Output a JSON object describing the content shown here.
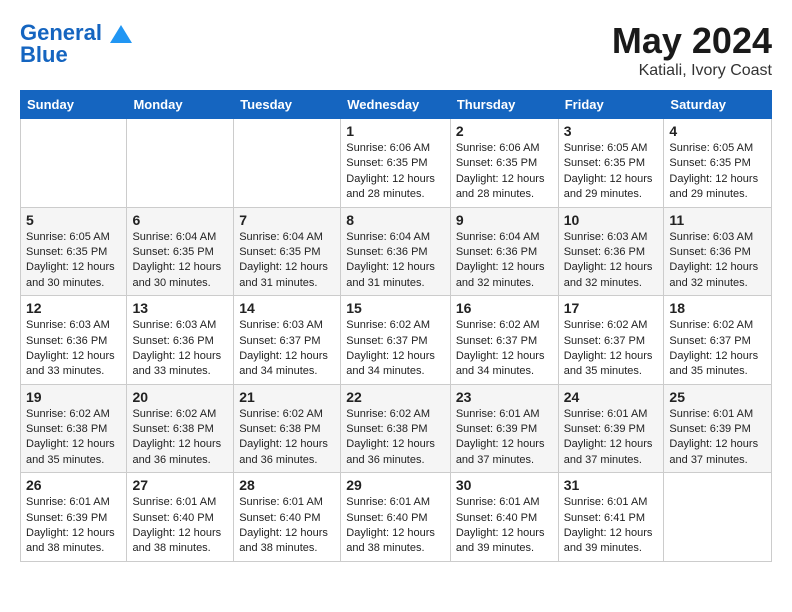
{
  "header": {
    "logo_line1": "General",
    "logo_line2": "Blue",
    "month_year": "May 2024",
    "location": "Katiali, Ivory Coast"
  },
  "weekdays": [
    "Sunday",
    "Monday",
    "Tuesday",
    "Wednesday",
    "Thursday",
    "Friday",
    "Saturday"
  ],
  "weeks": [
    [
      {
        "num": "",
        "detail": ""
      },
      {
        "num": "",
        "detail": ""
      },
      {
        "num": "",
        "detail": ""
      },
      {
        "num": "1",
        "detail": "Sunrise: 6:06 AM\nSunset: 6:35 PM\nDaylight: 12 hours\nand 28 minutes."
      },
      {
        "num": "2",
        "detail": "Sunrise: 6:06 AM\nSunset: 6:35 PM\nDaylight: 12 hours\nand 28 minutes."
      },
      {
        "num": "3",
        "detail": "Sunrise: 6:05 AM\nSunset: 6:35 PM\nDaylight: 12 hours\nand 29 minutes."
      },
      {
        "num": "4",
        "detail": "Sunrise: 6:05 AM\nSunset: 6:35 PM\nDaylight: 12 hours\nand 29 minutes."
      }
    ],
    [
      {
        "num": "5",
        "detail": "Sunrise: 6:05 AM\nSunset: 6:35 PM\nDaylight: 12 hours\nand 30 minutes."
      },
      {
        "num": "6",
        "detail": "Sunrise: 6:04 AM\nSunset: 6:35 PM\nDaylight: 12 hours\nand 30 minutes."
      },
      {
        "num": "7",
        "detail": "Sunrise: 6:04 AM\nSunset: 6:35 PM\nDaylight: 12 hours\nand 31 minutes."
      },
      {
        "num": "8",
        "detail": "Sunrise: 6:04 AM\nSunset: 6:36 PM\nDaylight: 12 hours\nand 31 minutes."
      },
      {
        "num": "9",
        "detail": "Sunrise: 6:04 AM\nSunset: 6:36 PM\nDaylight: 12 hours\nand 32 minutes."
      },
      {
        "num": "10",
        "detail": "Sunrise: 6:03 AM\nSunset: 6:36 PM\nDaylight: 12 hours\nand 32 minutes."
      },
      {
        "num": "11",
        "detail": "Sunrise: 6:03 AM\nSunset: 6:36 PM\nDaylight: 12 hours\nand 32 minutes."
      }
    ],
    [
      {
        "num": "12",
        "detail": "Sunrise: 6:03 AM\nSunset: 6:36 PM\nDaylight: 12 hours\nand 33 minutes."
      },
      {
        "num": "13",
        "detail": "Sunrise: 6:03 AM\nSunset: 6:36 PM\nDaylight: 12 hours\nand 33 minutes."
      },
      {
        "num": "14",
        "detail": "Sunrise: 6:03 AM\nSunset: 6:37 PM\nDaylight: 12 hours\nand 34 minutes."
      },
      {
        "num": "15",
        "detail": "Sunrise: 6:02 AM\nSunset: 6:37 PM\nDaylight: 12 hours\nand 34 minutes."
      },
      {
        "num": "16",
        "detail": "Sunrise: 6:02 AM\nSunset: 6:37 PM\nDaylight: 12 hours\nand 34 minutes."
      },
      {
        "num": "17",
        "detail": "Sunrise: 6:02 AM\nSunset: 6:37 PM\nDaylight: 12 hours\nand 35 minutes."
      },
      {
        "num": "18",
        "detail": "Sunrise: 6:02 AM\nSunset: 6:37 PM\nDaylight: 12 hours\nand 35 minutes."
      }
    ],
    [
      {
        "num": "19",
        "detail": "Sunrise: 6:02 AM\nSunset: 6:38 PM\nDaylight: 12 hours\nand 35 minutes."
      },
      {
        "num": "20",
        "detail": "Sunrise: 6:02 AM\nSunset: 6:38 PM\nDaylight: 12 hours\nand 36 minutes."
      },
      {
        "num": "21",
        "detail": "Sunrise: 6:02 AM\nSunset: 6:38 PM\nDaylight: 12 hours\nand 36 minutes."
      },
      {
        "num": "22",
        "detail": "Sunrise: 6:02 AM\nSunset: 6:38 PM\nDaylight: 12 hours\nand 36 minutes."
      },
      {
        "num": "23",
        "detail": "Sunrise: 6:01 AM\nSunset: 6:39 PM\nDaylight: 12 hours\nand 37 minutes."
      },
      {
        "num": "24",
        "detail": "Sunrise: 6:01 AM\nSunset: 6:39 PM\nDaylight: 12 hours\nand 37 minutes."
      },
      {
        "num": "25",
        "detail": "Sunrise: 6:01 AM\nSunset: 6:39 PM\nDaylight: 12 hours\nand 37 minutes."
      }
    ],
    [
      {
        "num": "26",
        "detail": "Sunrise: 6:01 AM\nSunset: 6:39 PM\nDaylight: 12 hours\nand 38 minutes."
      },
      {
        "num": "27",
        "detail": "Sunrise: 6:01 AM\nSunset: 6:40 PM\nDaylight: 12 hours\nand 38 minutes."
      },
      {
        "num": "28",
        "detail": "Sunrise: 6:01 AM\nSunset: 6:40 PM\nDaylight: 12 hours\nand 38 minutes."
      },
      {
        "num": "29",
        "detail": "Sunrise: 6:01 AM\nSunset: 6:40 PM\nDaylight: 12 hours\nand 38 minutes."
      },
      {
        "num": "30",
        "detail": "Sunrise: 6:01 AM\nSunset: 6:40 PM\nDaylight: 12 hours\nand 39 minutes."
      },
      {
        "num": "31",
        "detail": "Sunrise: 6:01 AM\nSunset: 6:41 PM\nDaylight: 12 hours\nand 39 minutes."
      },
      {
        "num": "",
        "detail": ""
      }
    ]
  ]
}
